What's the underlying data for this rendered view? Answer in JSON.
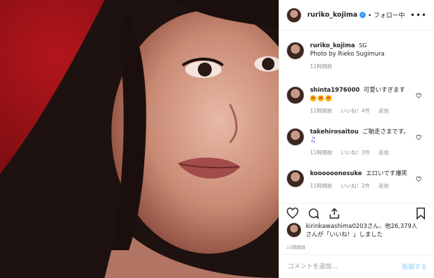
{
  "header": {
    "username": "ruriko_kojima",
    "follow_status": "• フォロー中",
    "more_icon": "ellipsis-icon"
  },
  "caption": {
    "username": "ruriko_kojima",
    "tag": "SG",
    "text": "Photo by Rieko Sugimura",
    "time": "11時間前"
  },
  "comments": [
    {
      "username": "shinta1976000",
      "text": "可愛いすぎます",
      "emoji_count": 3,
      "time": "11時間前",
      "likes": "いいね！4件",
      "reply": "返信"
    },
    {
      "username": "takehirosaitou",
      "text": "ご馳走さまです。",
      "extra": "♫",
      "time": "11時間前",
      "likes": "いいね！3件",
      "reply": "返信"
    },
    {
      "username": "koooooonosuke",
      "text": "エロいです爆笑",
      "time": "11時間前",
      "likes": "いいね！2件",
      "reply": "返信"
    }
  ],
  "likes": {
    "line1": "kirinkawashima0203さん、他26,379人",
    "line2": "さんが「いいね！」しました"
  },
  "post_time": "11時間前",
  "add_comment": {
    "placeholder": "コメントを追加...",
    "post_label": "投稿する"
  },
  "colors": {
    "accent": "#3897f0",
    "photo_background": "#7a0d12"
  }
}
